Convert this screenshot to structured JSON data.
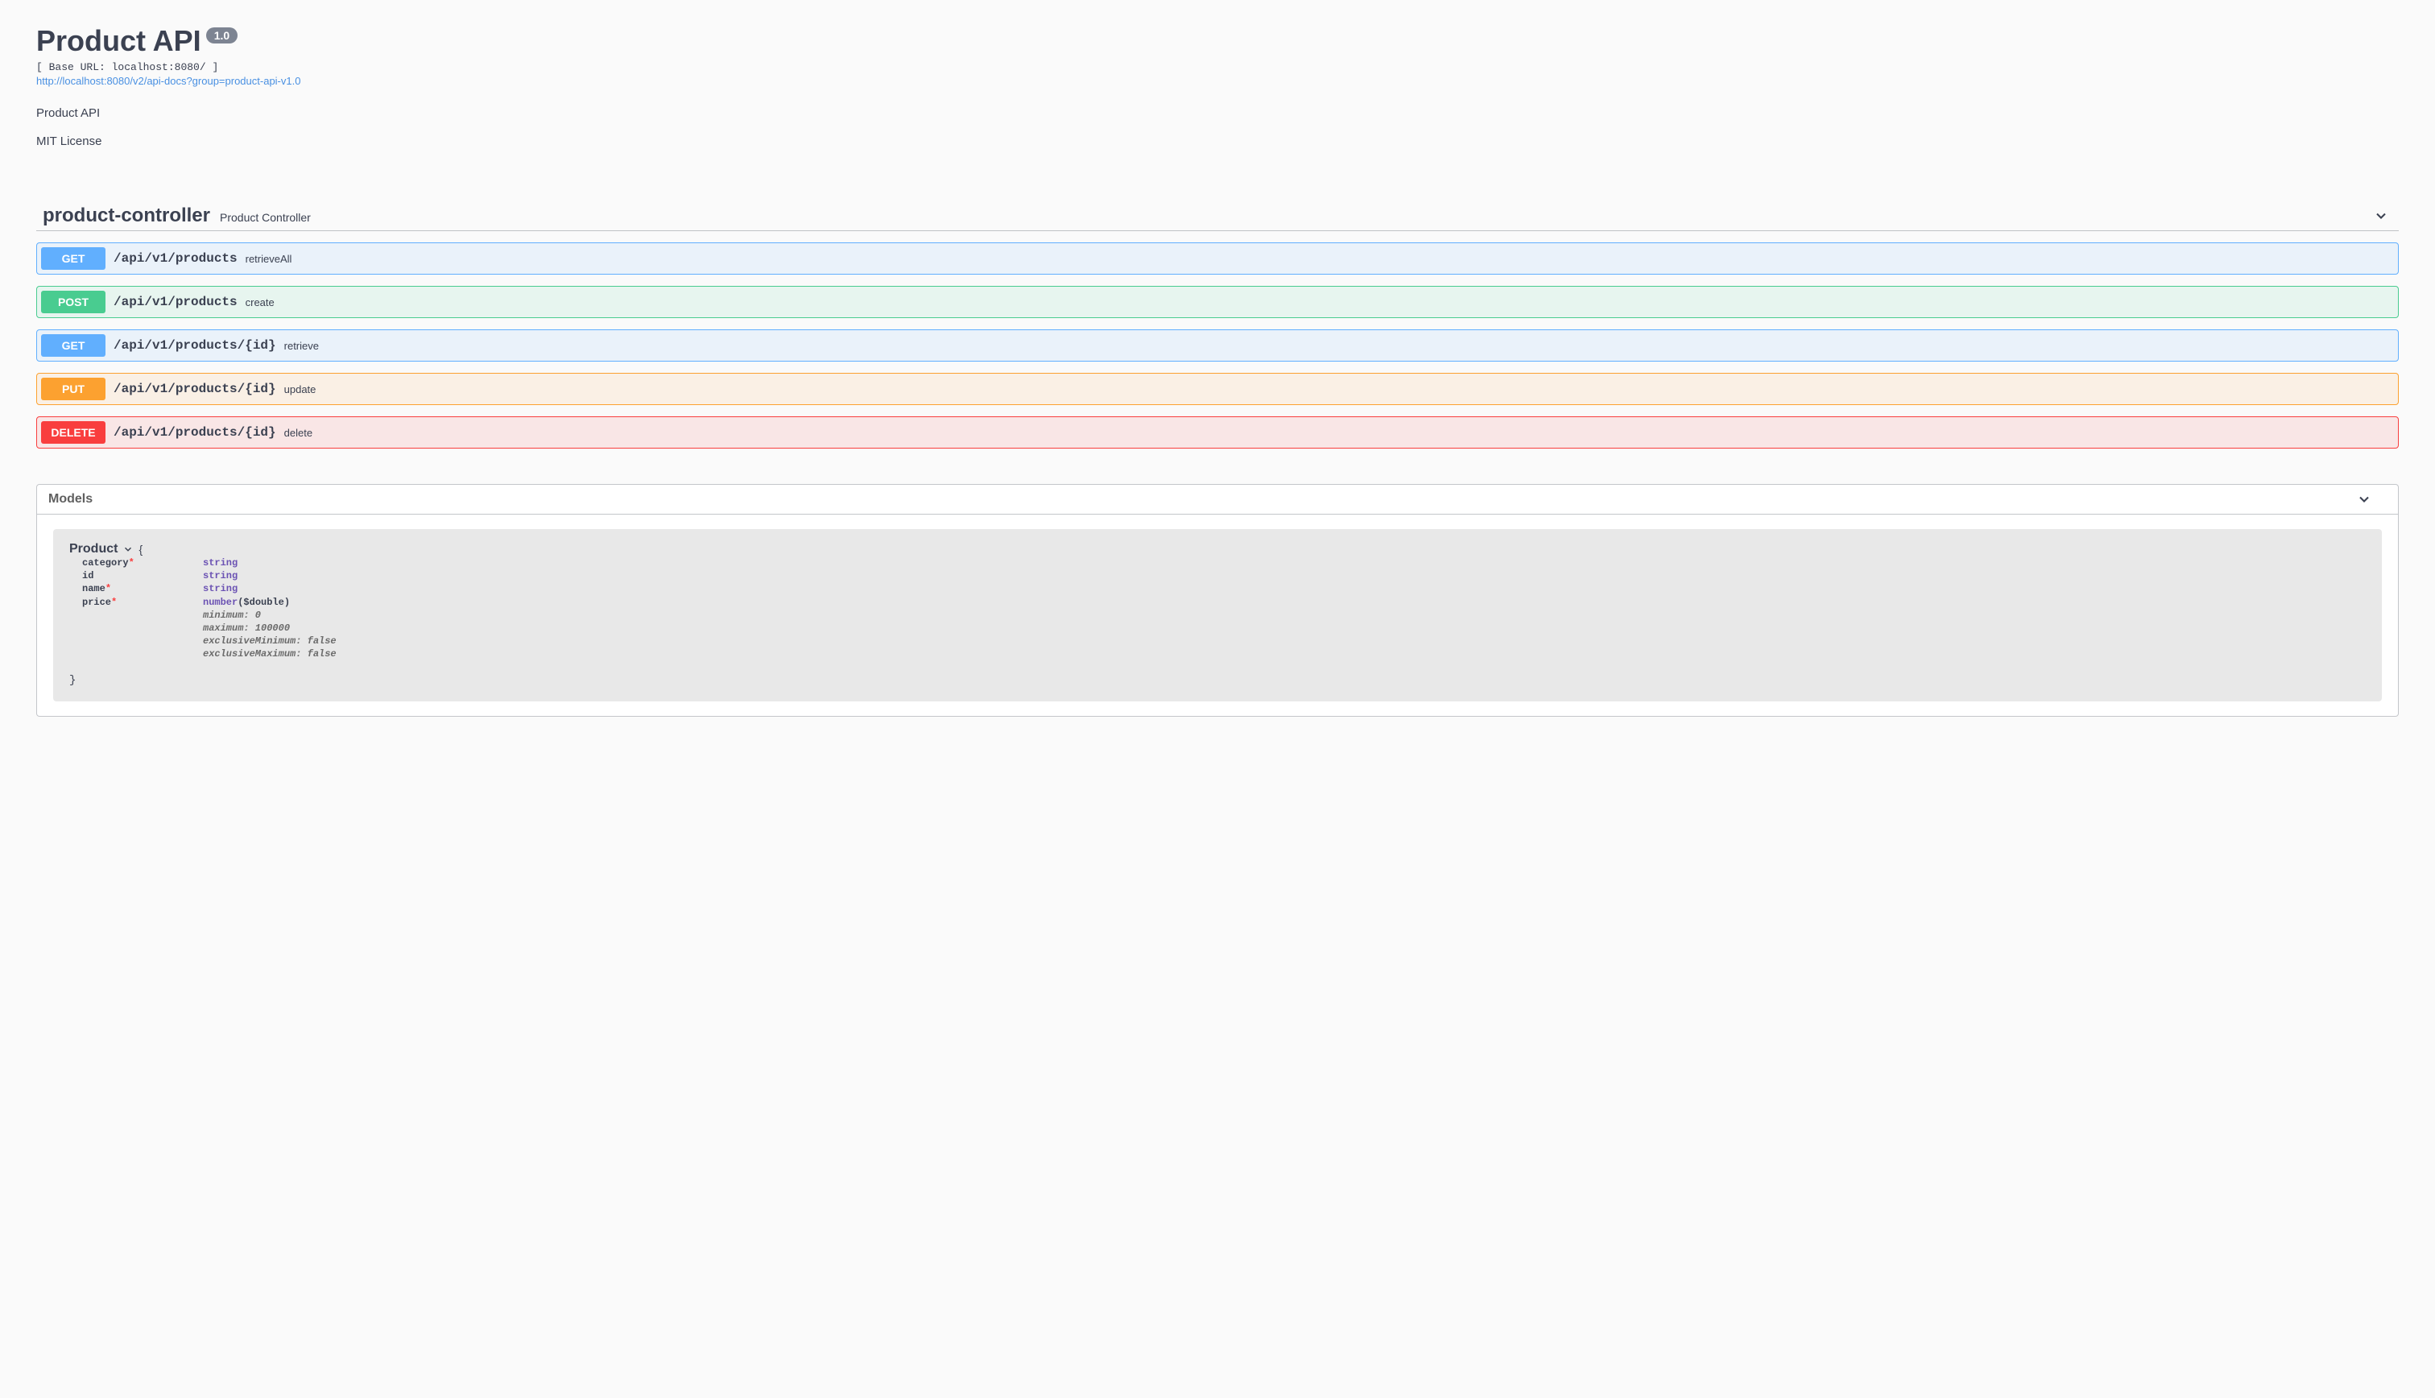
{
  "header": {
    "title": "Product API",
    "version": "1.0",
    "base_url_prefix": "[ Base URL: ",
    "base_url_value": "localhost:8080/",
    "base_url_suffix": " ]",
    "docs_link": "http://localhost:8080/v2/api-docs?group=product-api-v1.0",
    "description": "Product API",
    "license": "MIT License"
  },
  "controller": {
    "name": "product-controller",
    "description": "Product Controller"
  },
  "operations": [
    {
      "method": "GET",
      "css": "get",
      "path": "/api/v1/products",
      "summary": "retrieveAll"
    },
    {
      "method": "POST",
      "css": "post",
      "path": "/api/v1/products",
      "summary": "create"
    },
    {
      "method": "GET",
      "css": "get",
      "path": "/api/v1/products/{id}",
      "summary": "retrieve"
    },
    {
      "method": "PUT",
      "css": "put",
      "path": "/api/v1/products/{id}",
      "summary": "update"
    },
    {
      "method": "DELETE",
      "css": "delete",
      "path": "/api/v1/products/{id}",
      "summary": "delete"
    }
  ],
  "models": {
    "section_title": "Models",
    "items": [
      {
        "name": "Product",
        "properties": [
          {
            "key": "category",
            "required": true,
            "type": "string",
            "format": "",
            "extras": []
          },
          {
            "key": "id",
            "required": false,
            "type": "string",
            "format": "",
            "extras": []
          },
          {
            "key": "name",
            "required": true,
            "type": "string",
            "format": "",
            "extras": []
          },
          {
            "key": "price",
            "required": true,
            "type": "number",
            "format": "($double)",
            "extras": [
              "minimum: 0",
              "maximum: 100000",
              "exclusiveMinimum: false",
              "exclusiveMaximum: false"
            ]
          }
        ]
      }
    ]
  }
}
